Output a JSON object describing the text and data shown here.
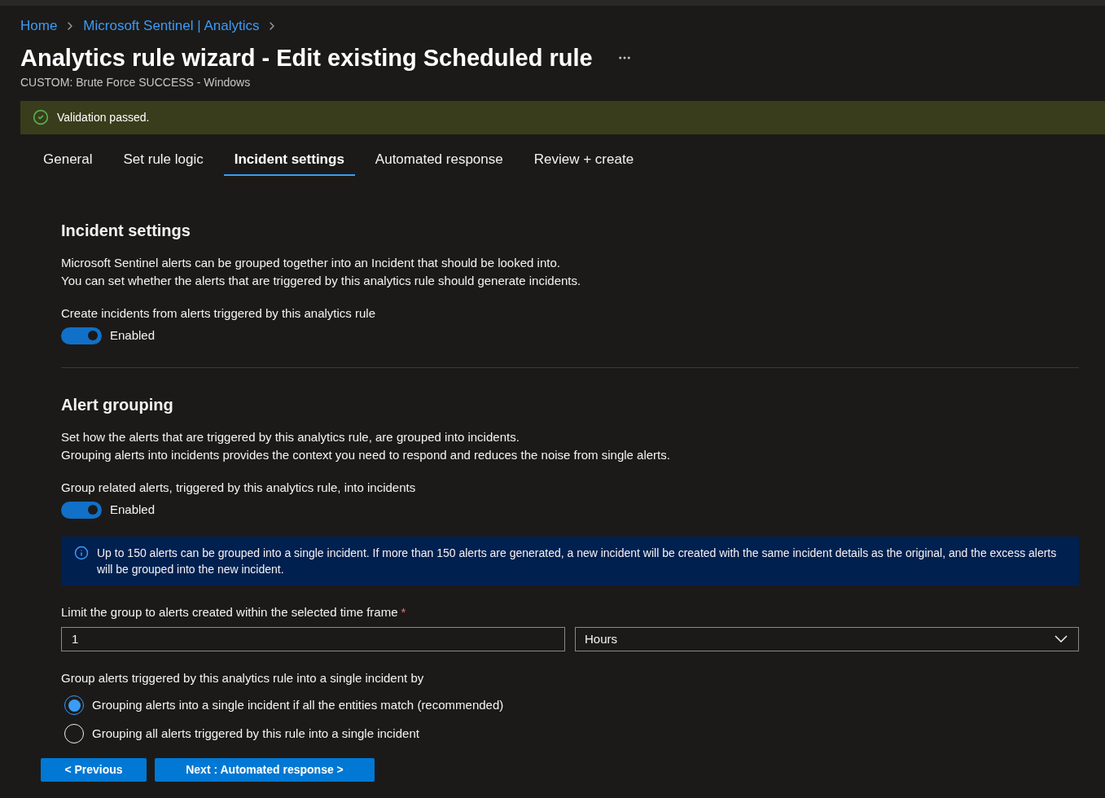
{
  "breadcrumb": [
    {
      "label": "Home"
    },
    {
      "label": "Microsoft Sentinel | Analytics"
    }
  ],
  "title": "Analytics rule wizard - Edit existing Scheduled rule",
  "subtitle": "CUSTOM: Brute Force SUCCESS - Windows",
  "validation": {
    "message": "Validation passed."
  },
  "tabs": [
    {
      "label": "General",
      "selected": false
    },
    {
      "label": "Set rule logic",
      "selected": false
    },
    {
      "label": "Incident settings",
      "selected": true
    },
    {
      "label": "Automated response",
      "selected": false
    },
    {
      "label": "Review + create",
      "selected": false
    }
  ],
  "incident_settings": {
    "heading": "Incident settings",
    "description": [
      "Microsoft Sentinel alerts can be grouped together into an Incident that should be looked into.",
      "You can set whether the alerts that are triggered by this analytics rule should generate incidents."
    ],
    "toggle": {
      "label": "Create incidents from alerts triggered by this analytics rule",
      "on": true,
      "state_text": "Enabled"
    }
  },
  "alert_grouping": {
    "heading": "Alert grouping",
    "description": [
      "Set how the alerts that are triggered by this analytics rule, are grouped into incidents.",
      "Grouping alerts into incidents provides the context you need to respond and reduces the noise from single alerts."
    ],
    "toggle": {
      "label": "Group related alerts, triggered by this analytics rule, into incidents",
      "on": true,
      "state_text": "Enabled"
    },
    "info": "Up to 150 alerts can be grouped into a single incident. If more than 150 alerts are generated, a new incident will be created with the same incident details as the original, and the excess alerts will be grouped into the new incident.",
    "time_frame": {
      "label": "Limit the group to alerts created within the selected time frame",
      "required_mark": "*",
      "value": "1",
      "unit": "Hours"
    },
    "group_by": {
      "label": "Group alerts triggered by this analytics rule into a single incident by",
      "options": [
        {
          "label": "Grouping alerts into a single incident if all the entities match (recommended)",
          "selected": true
        },
        {
          "label": "Grouping all alerts triggered by this rule into a single incident",
          "selected": false
        }
      ]
    }
  },
  "buttons": [
    {
      "label": "< Previous"
    },
    {
      "label": "Next : Automated response >"
    }
  ]
}
